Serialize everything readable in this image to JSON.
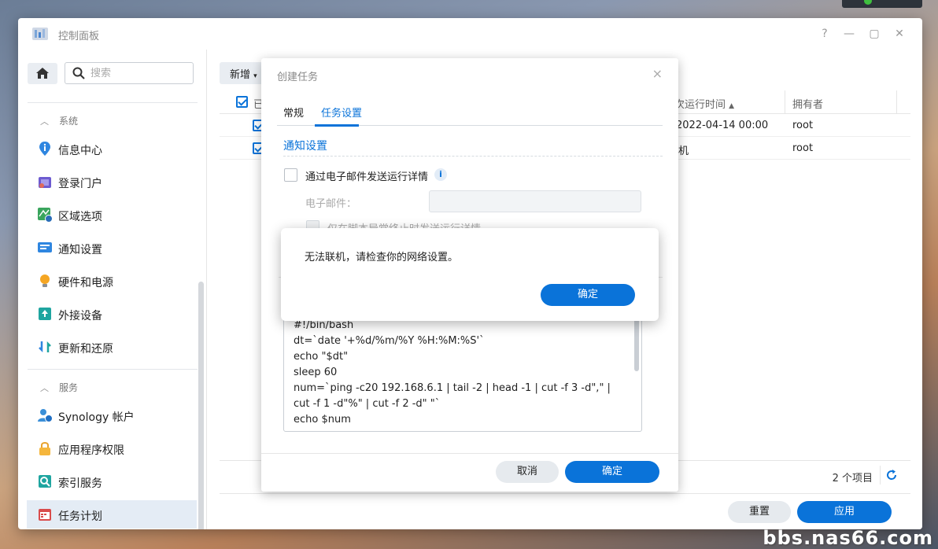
{
  "window": {
    "title": "控制面板"
  },
  "window_controls": {
    "help": "?",
    "minimize": "—",
    "maximize": "▢",
    "close": "✕"
  },
  "sidebar": {
    "search_placeholder": "搜索",
    "sections": [
      {
        "label": "系统",
        "chevron": "︿"
      },
      {
        "label": "服务",
        "chevron": "︿"
      }
    ],
    "items": [
      {
        "label": "信息中心",
        "icon": "info-icon"
      },
      {
        "label": "登录门户",
        "icon": "portal-icon"
      },
      {
        "label": "区域选项",
        "icon": "region-icon"
      },
      {
        "label": "通知设置",
        "icon": "notification-icon"
      },
      {
        "label": "硬件和电源",
        "icon": "bulb-icon"
      },
      {
        "label": "外接设备",
        "icon": "external-device-icon"
      },
      {
        "label": "更新和还原",
        "icon": "update-icon"
      },
      {
        "label": "Synology 帐户",
        "icon": "account-icon"
      },
      {
        "label": "应用程序权限",
        "icon": "lock-icon"
      },
      {
        "label": "索引服务",
        "icon": "index-icon"
      },
      {
        "label": "任务计划",
        "icon": "calendar-icon"
      }
    ]
  },
  "main": {
    "create_button": "新增",
    "grid": {
      "headers": {
        "enabled": "已",
        "next_run": "下次运行时间",
        "owner": "拥有者"
      },
      "rows": [
        {
          "next_run": "2022-04-14 00:00",
          "owner": "root"
        },
        {
          "next_run": "开机",
          "owner": "root"
        }
      ]
    },
    "item_count": "2 个项目",
    "reset_button": "重置",
    "apply_button": "应用"
  },
  "dialog": {
    "title": "创建任务",
    "close": "×",
    "tabs": [
      "常规",
      "任务设置"
    ],
    "section_title": "通知设置",
    "email_option": "通过电子邮件发送运行详情",
    "email_label": "电子邮件：",
    "abnormal_option": "仅在脚本异常终止时发送运行详情",
    "script_lines": [
      "#!/bin/bash",
      "dt=`date '+%d/%m/%Y %H:%M:%S'`",
      "echo \"$dt\"",
      "sleep 60",
      "num=`ping -c20 192.168.6.1 | tail -2 | head -1 | cut -f 3 -d\",\" |",
      "cut -f 1 -d\"%\" | cut -f 2 -d\" \"`",
      "echo $num"
    ],
    "cancel_button": "取消",
    "ok_button": "确定"
  },
  "alert": {
    "message": "无法联机，请检查你的网络设置。",
    "ok_button": "确定"
  },
  "watermark": "bbs.nas66.com",
  "colors": {
    "accent": "#0a73d9",
    "button_grey": "#e6eaee"
  }
}
